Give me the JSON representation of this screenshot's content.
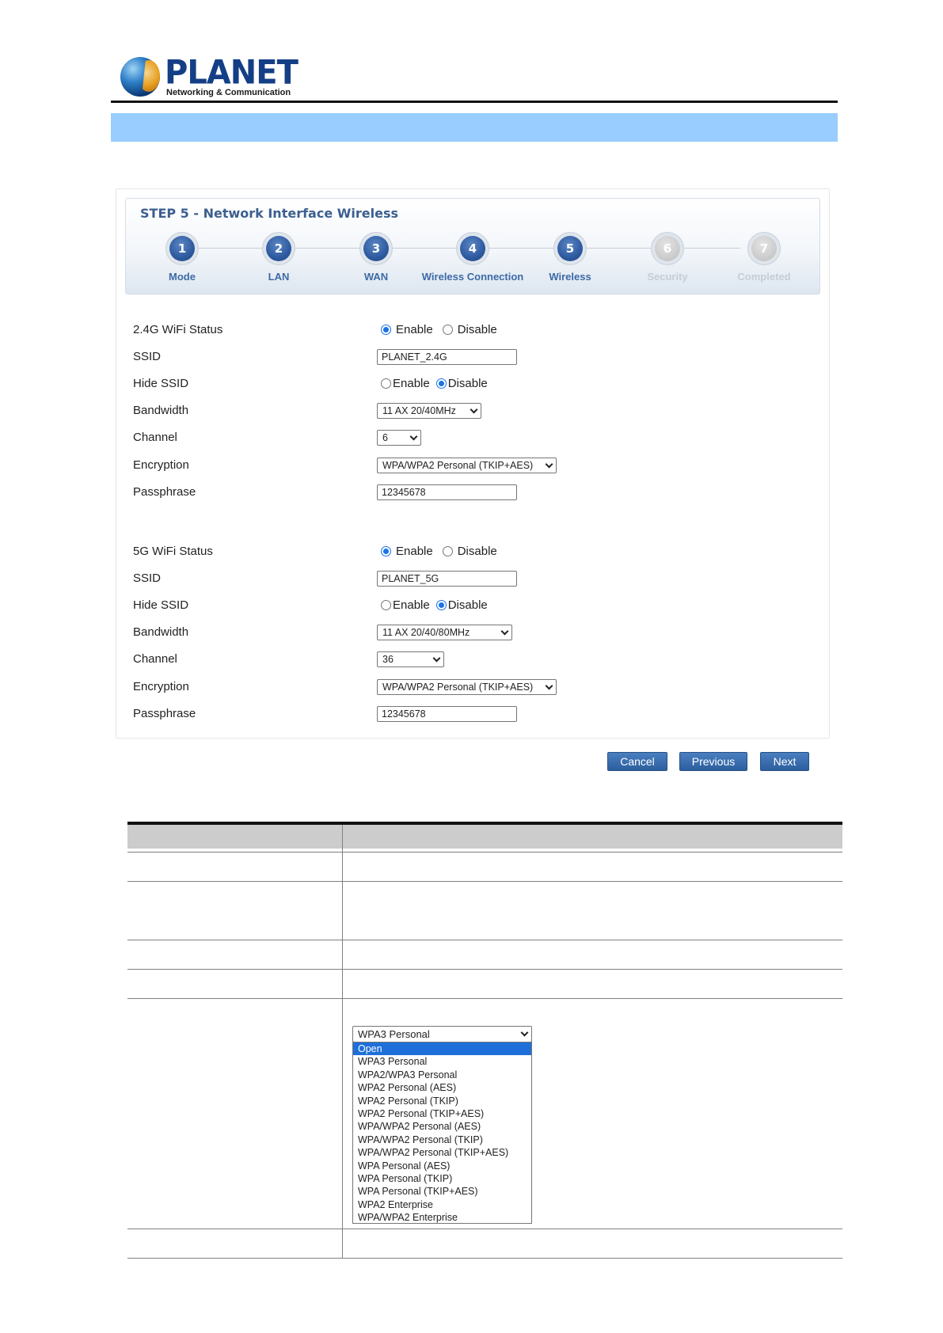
{
  "header": {
    "brand": "PLANET",
    "tagline": "Networking & Communication"
  },
  "wizard": {
    "title": "STEP 5 - Network Interface Wireless",
    "steps": [
      {
        "num": "1",
        "label": "Mode",
        "active": true
      },
      {
        "num": "2",
        "label": "LAN",
        "active": true
      },
      {
        "num": "3",
        "label": "WAN",
        "active": true
      },
      {
        "num": "4",
        "label": "Wireless Connection",
        "active": true
      },
      {
        "num": "5",
        "label": "Wireless",
        "active": true
      },
      {
        "num": "6",
        "label": "Security",
        "active": false
      },
      {
        "num": "7",
        "label": "Completed",
        "active": false
      }
    ]
  },
  "wifi24": {
    "status_label": "2.4G WiFi Status",
    "status_options": [
      "Enable",
      "Disable"
    ],
    "status_selected": "Enable",
    "ssid_label": "SSID",
    "ssid_value": "PLANET_2.4G",
    "hide_label": "Hide SSID",
    "hide_options": [
      "Enable",
      "Disable"
    ],
    "hide_selected": "Disable",
    "bandwidth_label": "Bandwidth",
    "bandwidth_value": "11 AX 20/40MHz",
    "channel_label": "Channel",
    "channel_value": "6",
    "encryption_label": "Encryption",
    "encryption_value": "WPA/WPA2 Personal (TKIP+AES)",
    "passphrase_label": "Passphrase",
    "passphrase_value": "12345678"
  },
  "wifi5": {
    "status_label": "5G WiFi Status",
    "status_options": [
      "Enable",
      "Disable"
    ],
    "status_selected": "Enable",
    "ssid_label": "SSID",
    "ssid_value": "PLANET_5G",
    "hide_label": "Hide SSID",
    "hide_options": [
      "Enable",
      "Disable"
    ],
    "hide_selected": "Disable",
    "bandwidth_label": "Bandwidth",
    "bandwidth_value": "11 AX 20/40/80MHz",
    "channel_label": "Channel",
    "channel_value": "36",
    "encryption_label": "Encryption",
    "encryption_value": "WPA/WPA2 Personal (TKIP+AES)",
    "passphrase_label": "Passphrase",
    "passphrase_value": "12345678"
  },
  "buttons": {
    "cancel": "Cancel",
    "previous": "Previous",
    "next": "Next"
  },
  "encryption_dropdown": {
    "selected": "WPA3 Personal",
    "options": [
      "Open",
      "WPA3 Personal",
      "WPA2/WPA3 Personal",
      "WPA2 Personal (AES)",
      "WPA2 Personal (TKIP)",
      "WPA2 Personal (TKIP+AES)",
      "WPA/WPA2 Personal (AES)",
      "WPA/WPA2 Personal (TKIP)",
      "WPA/WPA2 Personal (TKIP+AES)",
      "WPA Personal (AES)",
      "WPA Personal (TKIP)",
      "WPA Personal (TKIP+AES)",
      "WPA2 Enterprise",
      "WPA/WPA2 Enterprise"
    ],
    "highlighted": "Open"
  }
}
